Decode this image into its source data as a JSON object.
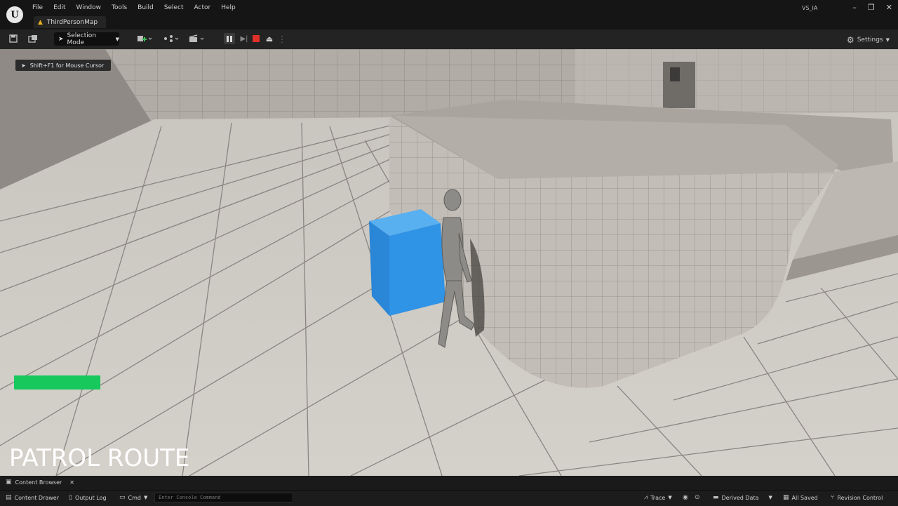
{
  "app": {
    "logo_letter": "U",
    "menu": [
      "File",
      "Edit",
      "Window",
      "Tools",
      "Build",
      "Select",
      "Actor",
      "Help"
    ],
    "map_tab": "ThirdPersonMap",
    "project_name": "VS_IA",
    "window_controls": {
      "minimize": "–",
      "maximize": "❐",
      "close": "✕"
    }
  },
  "toolbar": {
    "selection_mode": "Selection Mode",
    "settings": "Settings"
  },
  "viewport": {
    "hint": "Shift+F1 for Mouse Cursor",
    "caption": "PATROL ROUTE",
    "health_bar_fill": 1.0,
    "colors": {
      "health": "#17c85c",
      "cube": "#2f93e6"
    }
  },
  "bottom": {
    "content_browser_tab": "Content Browser",
    "content_drawer": "Content Drawer",
    "output_log": "Output Log",
    "cmd": "Cmd",
    "console_placeholder": "Enter Console Command",
    "trace": "Trace",
    "derived_data": "Derived Data",
    "all_saved": "All Saved",
    "revision_control": "Revision Control"
  }
}
